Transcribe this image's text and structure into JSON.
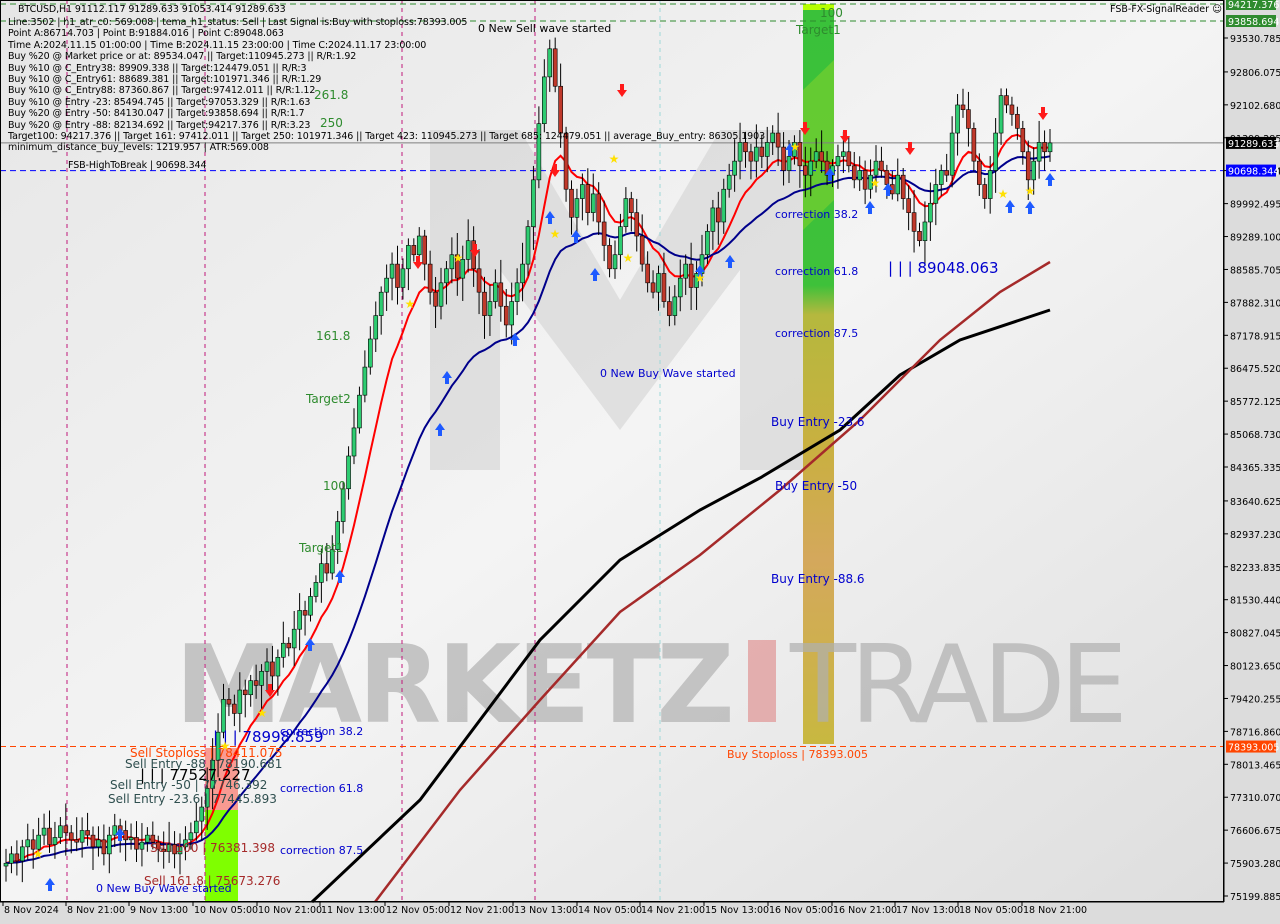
{
  "header": {
    "symbol_line": "BTCUSD,H1  91112.117 91289.633 91053.414 91289.633",
    "info_lines": [
      "Line:3502 | h1_atr_c0: 569.008 | tema_h1_status: Sell | Last Signal is:Buy with stoploss:78393.005",
      "Point A:86714.703 | Point B:91884.016 | Point C:89048.063",
      "Time A:2024.11.15 01:00:00 | Time B:2024.11.15 23:00:00 | Time C:2024.11.17 23:00:00",
      "Buy %20 @ Market price or at: 89534.047 || Target:110945.273 || R/R:1.92",
      "Buy %10 @ C_Entry38: 89909.338 || Target:124479.051 || R/R:3",
      "Buy %10 @ C_Entry61: 88689.381 || Target:101971.346 || R/R:1.29",
      "Buy %10 @ C_Entry88: 87360.867 || Target:97412.011 || R/R:1.12",
      "Buy %10 @ Entry -23: 85494.745 || Target:97053.329 || R/R:1.63",
      "Buy %20 @ Entry -50: 84130.047 || Target:93858.694 || R/R:1.7",
      "Buy %20 @ Entry -88: 82134.692 || Target:94217.376 || R/R:3.23",
      "Target100: 94217.376 || Target 161: 97412.011 || Target 250: 101971.346 || Target 423: 110945.273 || Target 685: 124479.051 || average_Buy_entry: 86305.1903",
      "minimum_distance_buy_levels: 1219.957 | ATR:569.008"
    ],
    "indicator_name": "FSB-FX-SignalReader",
    "smiley_icon": "☺"
  },
  "colors": {
    "background": "#dcdcdc",
    "bull_candle": "#2ecc71",
    "bear_candle": "#c0392b",
    "ema_red": "#ff0000",
    "ma_blue": "#00008b",
    "ma_black": "#000000",
    "ma_darkred": "#a52a2a",
    "label_blue": "#0000ff",
    "target_green": "#2e8b2e",
    "stoploss_orange": "#ff4500",
    "axis_green_badge": "#2e8b2e",
    "axis_blue_badge": "#0000ff",
    "axis_orange_badge": "#ff4500"
  },
  "chart_data": {
    "type": "candlestick",
    "title": "BTCUSD,H1",
    "ylim": [
      74900,
      94500
    ],
    "y_ticks": [
      "93530.785",
      "92806.075",
      "92102.680",
      "91399.285",
      "90698.344",
      "89992.495",
      "89289.100",
      "88585.705",
      "87882.310",
      "87178.915",
      "86475.520",
      "85772.125",
      "85068.730",
      "84365.335",
      "83640.625",
      "82937.230",
      "82233.835",
      "81530.440",
      "80827.045",
      "80123.650",
      "79420.255",
      "78716.860",
      "78013.465",
      "77310.070",
      "76606.675",
      "75903.280",
      "75199.885"
    ],
    "x_ticks": [
      "8 Nov 2024",
      "8 Nov 21:00",
      "9 Nov 13:00",
      "10 Nov 05:00",
      "10 Nov 21:00",
      "11 Nov 13:00",
      "12 Nov 05:00",
      "12 Nov 21:00",
      "13 Nov 13:00",
      "14 Nov 05:00",
      "14 Nov 21:00",
      "15 Nov 13:00",
      "16 Nov 05:00",
      "16 Nov 21:00",
      "17 Nov 13:00",
      "18 Nov 05:00",
      "18 Nov 21:00"
    ],
    "current_price": {
      "value": 91289.633,
      "label": "91289.633"
    },
    "price_badges": [
      {
        "name": "target100",
        "label": "94217.376",
        "value": 94217.376,
        "color": "#2e8b2e"
      },
      {
        "name": "target-50",
        "label": "93858.694",
        "value": 93858.694,
        "color": "#2e8b2e"
      },
      {
        "name": "high-to-break",
        "label": "90698.344",
        "value": 90698.344,
        "color": "#0000ff"
      },
      {
        "name": "stoploss",
        "label": "78393.005",
        "value": 78393.005,
        "color": "#ff4500"
      }
    ],
    "horizontal_lines": [
      {
        "name": "high-to-break",
        "value": 90698.344,
        "label": "FSB-HighToBreak | 90698.344",
        "color": "#0000ff",
        "style": "dashed"
      },
      {
        "name": "stoploss",
        "value": 78393.005,
        "color": "#ff4500",
        "style": "dashed"
      },
      {
        "name": "target100-line",
        "value": 94217.376,
        "color": "#2e8b2e",
        "style": "dashed"
      },
      {
        "name": "target-50-line",
        "value": 93858.694,
        "color": "#2e8b2e",
        "style": "dashed"
      },
      {
        "name": "price-line",
        "value": 91289.633,
        "color": "#808080",
        "style": "solid"
      }
    ],
    "series": [
      {
        "name": "price_close",
        "type": "candle",
        "values": [
          75900,
          76100,
          75950,
          76250,
          76400,
          76200,
          76500,
          76650,
          76300,
          76450,
          76700,
          76550,
          76400,
          76350,
          76600,
          76500,
          76250,
          76400,
          76100,
          76500,
          76700,
          76600,
          76400,
          76450,
          76200,
          76350,
          76500,
          76350,
          76200,
          76150,
          76300,
          76100,
          76250,
          76400,
          76550,
          76800,
          77100,
          77500,
          78100,
          78700,
          79400,
          79300,
          79100,
          79600,
          79500,
          79800,
          79700,
          80000,
          80200,
          79900,
          80300,
          80600,
          80500,
          80900,
          81300,
          81200,
          81600,
          81900,
          82300,
          82100,
          82600,
          83200,
          83900,
          84600,
          85200,
          85900,
          86500,
          87100,
          87600,
          88100,
          88400,
          88700,
          88200,
          88600,
          89100,
          88900,
          89300,
          88700,
          88100,
          87800,
          88300,
          88600,
          88900,
          88400,
          88800,
          89200,
          88600,
          88100,
          87600,
          87900,
          88300,
          87800,
          87400,
          87900,
          88300,
          88700,
          89500,
          90500,
          91700,
          92700,
          93300,
          92500,
          91500,
          90300,
          89700,
          90100,
          90400,
          89800,
          90200,
          89600,
          89100,
          88600,
          88900,
          89500,
          90100,
          89800,
          89300,
          88700,
          88300,
          88100,
          88500,
          87900,
          87600,
          88000,
          88400,
          88700,
          88200,
          88500,
          88900,
          89400,
          89900,
          89600,
          90300,
          90600,
          90900,
          91300,
          91100,
          90900,
          91200,
          91000,
          91300,
          91500,
          91200,
          90700,
          91000,
          91300,
          90800,
          90600,
          90900,
          91100,
          90900,
          90600,
          90800,
          91000,
          91100,
          90800,
          90500,
          90700,
          90300,
          90600,
          90900,
          90700,
          90400,
          90200,
          90600,
          90100,
          89800,
          89400,
          89200,
          89600,
          90000,
          90400,
          90700,
          90600,
          91500,
          92100,
          92000,
          91600,
          90900,
          90400,
          90100,
          90700,
          91500,
          92300,
          92100,
          91900,
          91600,
          91100,
          90500,
          90900,
          91300,
          91100,
          91289
        ]
      },
      {
        "name": "ema_red",
        "type": "line",
        "color": "#ff0000"
      },
      {
        "name": "ma_blue",
        "type": "line",
        "color": "#00008b"
      },
      {
        "name": "ma_black",
        "type": "line",
        "color": "#000000"
      },
      {
        "name": "ma_darkred",
        "type": "line",
        "color": "#a52a2a"
      }
    ],
    "annotations": {
      "wave_labels": [
        {
          "text": "0 New Sell wave started",
          "color": "#000000"
        },
        {
          "text": "0 New Buy Wave started",
          "color": "#0000cd"
        },
        {
          "text": "0 New Buy Wave started",
          "color": "#0000cd"
        }
      ],
      "targets_left": [
        {
          "text": "261.8",
          "color": "#2e8b2e"
        },
        {
          "text": "250",
          "color": "#2e8b2e"
        },
        {
          "text": "161.8",
          "color": "#2e8b2e"
        },
        {
          "text": "Target2",
          "color": "#2e8b2e"
        },
        {
          "text": "100",
          "color": "#2e8b2e"
        },
        {
          "text": "Target1",
          "color": "#2e8b2e"
        }
      ],
      "targets_right": [
        {
          "text": "100",
          "color": "#2e8b2e"
        },
        {
          "text": "Target1",
          "color": "#2e8b2e"
        }
      ],
      "corrections_right": [
        "correction 38.2",
        "correction 61.8",
        "correction 87.5"
      ],
      "corrections_left": [
        "correction 38.2",
        "correction 61.8",
        "correction 87.5"
      ],
      "buy_entries": [
        "Buy Entry -23.6",
        "Buy Entry -50",
        "Buy Entry -88.6"
      ],
      "buy_stoploss": "Buy Stoploss | 78393.005",
      "point_c_label": "| | | 89048.063",
      "sell_labels": {
        "wave": "| | | 78998.859",
        "stoploss": "Sell Stoploss | 78411.075",
        "entry_88": "Sell Entry -88 | 78190.681",
        "point": "| | | 77527.227",
        "entry_50": "Sell Entry -50 | 77746.392",
        "entry_23": "Sell Entry -23.6 | 77445.893",
        "sell_100": "Sell 100 | 76381.398",
        "sell_161": "Sell 161.8 | 75673.276"
      },
      "watermark_left": "MARKETZ",
      "watermark_right": "TRADE"
    }
  }
}
